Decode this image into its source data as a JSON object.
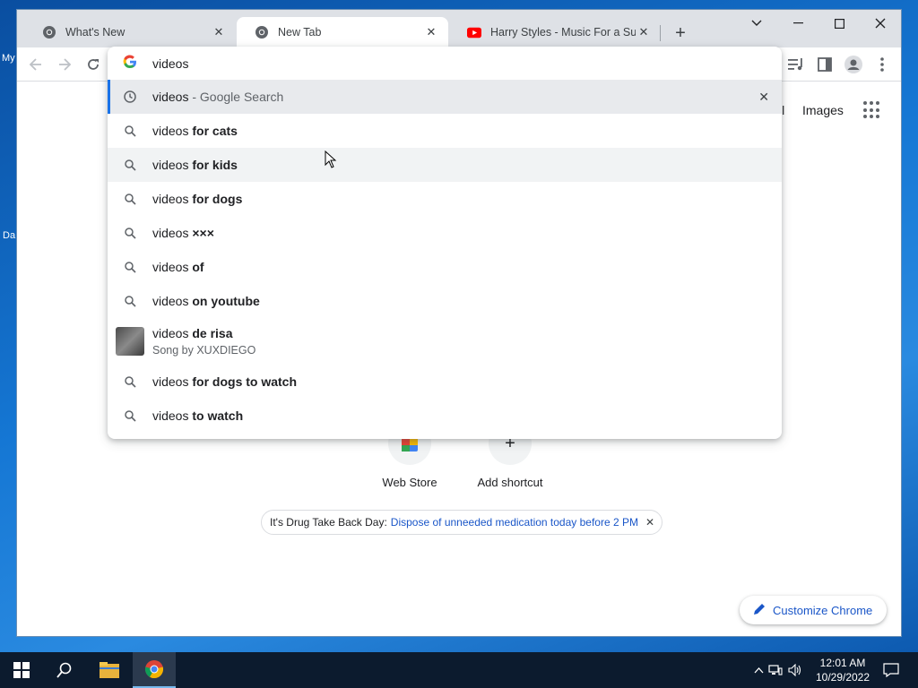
{
  "desktop": {
    "frag_top": "My",
    "frag_bottom": "Da"
  },
  "tabs": [
    {
      "title": "What's New",
      "icon": "chrome-icon"
    },
    {
      "title": "New Tab",
      "icon": "chrome-icon"
    },
    {
      "title": "Harry Styles - Music For a Sushi",
      "icon": "youtube-icon"
    }
  ],
  "omnibox": {
    "value": "videos",
    "suggestions": [
      {
        "prefix": "videos",
        "suffix": "",
        "muted": " - Google Search",
        "icon": "history-icon",
        "selected": true
      },
      {
        "prefix": "videos ",
        "suffix": "for cats",
        "icon": "search-icon"
      },
      {
        "prefix": "videos ",
        "suffix": "for kids",
        "icon": "search-icon"
      },
      {
        "prefix": "videos ",
        "suffix": "for dogs",
        "icon": "search-icon"
      },
      {
        "prefix": "videos ",
        "suffix": "×××",
        "icon": "search-icon"
      },
      {
        "prefix": "videos ",
        "suffix": "of",
        "icon": "search-icon"
      },
      {
        "prefix": "videos ",
        "suffix": "on youtube",
        "icon": "search-icon"
      },
      {
        "prefix": "videos ",
        "suffix": "de risa",
        "sub": "Song by XUXDIEGO",
        "icon": "song-thumbnail"
      },
      {
        "prefix": "videos ",
        "suffix": "for dogs to watch",
        "icon": "search-icon"
      },
      {
        "prefix": "videos ",
        "suffix": "to watch",
        "icon": "search-icon"
      }
    ]
  },
  "page": {
    "top_links": {
      "gmail_partial": "il",
      "images": "Images"
    },
    "shortcuts": [
      {
        "label": "Web Store"
      },
      {
        "label": "Add shortcut"
      }
    ],
    "promo": {
      "lead": "It's Drug Take Back Day:",
      "link": "Dispose of unneeded medication today before 2 PM"
    },
    "customize_label": "Customize Chrome"
  },
  "taskbar": {
    "time": "12:01 AM",
    "date": "10/29/2022"
  },
  "colors": {
    "accent": "#1a73e8",
    "link": "#1a56c8",
    "youtube": "#ff0000",
    "taskbar": "#0c1b2e"
  }
}
